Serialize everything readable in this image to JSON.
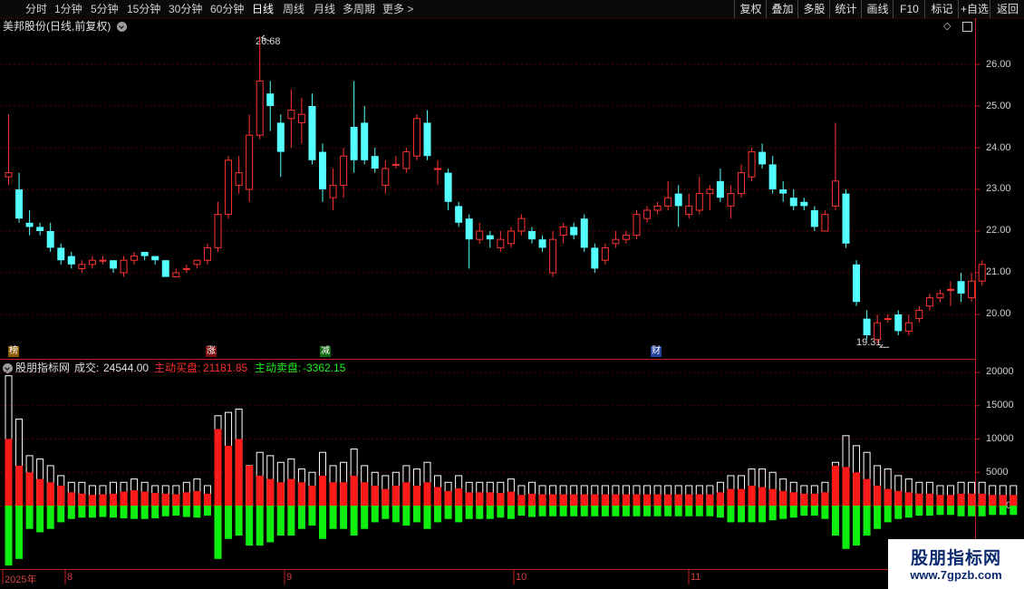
{
  "timeframes": [
    "分时",
    "1分钟",
    "5分钟",
    "15分钟",
    "30分钟",
    "60分钟",
    "日线",
    "周线",
    "月线",
    "多周期",
    "更多 >"
  ],
  "active_timeframe": "日线",
  "right_buttons": [
    "复权",
    "叠加",
    "多股",
    "统计",
    "画线",
    "F10",
    "标记",
    "+自选",
    "返回"
  ],
  "main_chart": {
    "title": "美邦股份(日线,前复权)",
    "high_label": "26.68",
    "low_label": "19.31",
    "y_labels": [
      "26.00",
      "25.00",
      "24.00",
      "23.00",
      "22.00",
      "21.00",
      "20.00"
    ],
    "event_tags": [
      "榜",
      "涨",
      "减",
      "财"
    ]
  },
  "sub_chart": {
    "name": "股朋指标网",
    "vol_label": "成交:",
    "vol_value": "24544.00",
    "buy_label": "主动买盘:",
    "buy_value": "21181.85",
    "sell_label": "主动卖盘:",
    "sell_value": "-3362.15",
    "y_labels": [
      "20000",
      "15000",
      "10000",
      "5000",
      "0"
    ]
  },
  "date_axis": [
    "2025年",
    "8",
    "9",
    "10",
    "11"
  ],
  "watermark": {
    "line1": "股朋指标网",
    "line2": "www.7gpzb.com"
  },
  "colors": {
    "up": "#ff3232",
    "down": "#54ffff",
    "buy": "#ff1a1a",
    "sell": "#10f010",
    "grid": "#5a0000",
    "axis": "#c02020"
  },
  "chart_data": [
    {
      "type": "candlestick",
      "title": "美邦股份(日线,前复权)",
      "ylim": [
        19.0,
        26.9
      ],
      "candles": [
        [
          23.3,
          23.4,
          24.8,
          23.1
        ],
        [
          23.0,
          22.3,
          23.4,
          22.2
        ],
        [
          22.2,
          22.1,
          22.5,
          21.9
        ],
        [
          22.1,
          22.0,
          22.2,
          21.9
        ],
        [
          22.0,
          21.6,
          22.2,
          21.5
        ],
        [
          21.6,
          21.3,
          21.7,
          21.2
        ],
        [
          21.4,
          21.2,
          21.5,
          21.1
        ],
        [
          21.1,
          21.2,
          21.3,
          21.0
        ],
        [
          21.2,
          21.3,
          21.4,
          21.1
        ],
        [
          21.3,
          21.3,
          21.4,
          21.2
        ],
        [
          21.3,
          21.1,
          21.3,
          21.0
        ],
        [
          21.0,
          21.3,
          21.4,
          20.9
        ],
        [
          21.3,
          21.4,
          21.5,
          21.2
        ],
        [
          21.5,
          21.4,
          21.5,
          21.3
        ],
        [
          21.4,
          21.3,
          21.4,
          21.2
        ],
        [
          21.3,
          20.9,
          21.3,
          20.9
        ],
        [
          20.9,
          21.0,
          21.1,
          20.9
        ],
        [
          21.1,
          21.1,
          21.2,
          21.0
        ],
        [
          21.2,
          21.3,
          21.3,
          21.1
        ],
        [
          21.3,
          21.6,
          21.7,
          21.2
        ],
        [
          21.6,
          22.4,
          22.7,
          21.5
        ],
        [
          22.4,
          23.7,
          23.8,
          22.3
        ],
        [
          23.1,
          23.4,
          23.8,
          22.9
        ],
        [
          23.0,
          24.3,
          24.8,
          22.7
        ],
        [
          24.3,
          25.6,
          26.68,
          24.2
        ],
        [
          25.3,
          25.0,
          25.6,
          24.4
        ],
        [
          24.6,
          23.9,
          24.8,
          23.3
        ],
        [
          24.7,
          24.9,
          25.4,
          24.0
        ],
        [
          24.6,
          24.8,
          25.2,
          24.1
        ],
        [
          25.0,
          23.7,
          25.3,
          23.6
        ],
        [
          23.9,
          23.0,
          24.1,
          22.7
        ],
        [
          22.8,
          23.1,
          23.5,
          22.5
        ],
        [
          23.1,
          23.8,
          24.0,
          22.8
        ],
        [
          24.5,
          23.7,
          25.6,
          23.4
        ],
        [
          24.6,
          23.7,
          25.0,
          23.6
        ],
        [
          23.8,
          23.5,
          24.0,
          23.4
        ],
        [
          23.1,
          23.5,
          23.7,
          22.9
        ],
        [
          23.6,
          23.6,
          23.8,
          23.5
        ],
        [
          23.5,
          23.9,
          24.0,
          23.4
        ],
        [
          23.8,
          24.7,
          24.8,
          23.7
        ],
        [
          24.6,
          23.8,
          24.9,
          23.7
        ],
        [
          23.5,
          23.5,
          23.7,
          23.1
        ],
        [
          23.4,
          22.7,
          23.5,
          22.5
        ],
        [
          22.6,
          22.2,
          22.7,
          22.1
        ],
        [
          22.3,
          21.8,
          22.4,
          21.1
        ],
        [
          21.8,
          22.0,
          22.2,
          21.7
        ],
        [
          21.9,
          21.8,
          22.0,
          21.6
        ],
        [
          21.6,
          21.8,
          22.0,
          21.5
        ],
        [
          21.7,
          22.0,
          22.1,
          21.6
        ],
        [
          22.0,
          22.3,
          22.4,
          21.9
        ],
        [
          22.0,
          21.8,
          22.1,
          21.7
        ],
        [
          21.8,
          21.6,
          21.9,
          21.5
        ],
        [
          21.0,
          21.8,
          22.0,
          20.9
        ],
        [
          21.9,
          22.1,
          22.2,
          21.7
        ],
        [
          22.1,
          21.9,
          22.2,
          21.8
        ],
        [
          22.3,
          21.6,
          22.4,
          21.5
        ],
        [
          21.6,
          21.1,
          21.7,
          21.0
        ],
        [
          21.3,
          21.6,
          21.7,
          21.2
        ],
        [
          21.7,
          21.8,
          22.0,
          21.6
        ],
        [
          21.8,
          21.9,
          22.0,
          21.7
        ],
        [
          21.9,
          22.4,
          22.5,
          21.8
        ],
        [
          22.3,
          22.5,
          22.6,
          22.2
        ],
        [
          22.5,
          22.6,
          22.7,
          22.4
        ],
        [
          22.6,
          22.8,
          23.2,
          22.5
        ],
        [
          22.9,
          22.6,
          23.1,
          22.1
        ],
        [
          22.4,
          22.6,
          22.9,
          22.3
        ],
        [
          22.5,
          22.9,
          23.3,
          22.4
        ],
        [
          22.9,
          23.0,
          23.1,
          22.5
        ],
        [
          23.2,
          22.8,
          23.5,
          22.7
        ],
        [
          22.6,
          22.9,
          23.1,
          22.3
        ],
        [
          22.9,
          23.4,
          23.6,
          22.8
        ],
        [
          23.3,
          23.9,
          24.0,
          23.2
        ],
        [
          23.9,
          23.6,
          24.1,
          23.5
        ],
        [
          23.6,
          23.0,
          23.8,
          22.9
        ],
        [
          23.0,
          22.9,
          23.2,
          22.7
        ],
        [
          22.8,
          22.6,
          23.0,
          22.5
        ],
        [
          22.7,
          22.6,
          22.8,
          22.5
        ],
        [
          22.5,
          22.1,
          22.6,
          22.0
        ],
        [
          22.0,
          22.4,
          22.5,
          22.0
        ],
        [
          22.6,
          23.2,
          24.6,
          22.5
        ],
        [
          22.9,
          21.7,
          23.0,
          21.6
        ],
        [
          21.2,
          20.3,
          21.3,
          20.2
        ],
        [
          19.9,
          19.5,
          20.1,
          19.4
        ],
        [
          19.4,
          19.8,
          20.0,
          19.3
        ],
        [
          19.9,
          19.9,
          20.0,
          19.8
        ],
        [
          20.0,
          19.6,
          20.1,
          19.5
        ],
        [
          19.6,
          19.8,
          20.0,
          19.5
        ],
        [
          19.9,
          20.1,
          20.2,
          19.8
        ],
        [
          20.2,
          20.4,
          20.5,
          20.1
        ],
        [
          20.4,
          20.5,
          20.6,
          20.3
        ],
        [
          20.6,
          20.6,
          20.8,
          20.2
        ],
        [
          20.8,
          20.5,
          21.0,
          20.3
        ],
        [
          20.4,
          20.8,
          21.0,
          20.3
        ],
        [
          20.8,
          21.2,
          21.3,
          20.7
        ]
      ]
    },
    {
      "type": "bar",
      "title": "股朋指标网",
      "series": [
        {
          "name": "成交",
          "values": [
            19500,
            13000,
            7500,
            7000,
            6000,
            4500,
            3500,
            3500,
            3000,
            3000,
            3500,
            3500,
            4000,
            3500,
            3000,
            3000,
            3000,
            3500,
            4000,
            3000,
            13500,
            14000,
            14500,
            6000,
            8000,
            7500,
            6500,
            7000,
            5500,
            5000,
            8000,
            6000,
            6500,
            8500,
            6000,
            5000,
            4500,
            5000,
            6000,
            5500,
            6500,
            4500,
            3500,
            4500,
            3500,
            3500,
            3500,
            3500,
            4000,
            3000,
            3500,
            3000,
            3000,
            3000,
            3000,
            3000,
            3000,
            3000,
            3000,
            3000,
            3000,
            3000,
            3000,
            3000,
            3000,
            3000,
            3000,
            3000,
            3500,
            4500,
            4500,
            5500,
            5500,
            5000,
            4000,
            3500,
            3000,
            3000,
            3500,
            6500,
            10500,
            9000,
            8000,
            6000,
            5500,
            4500,
            4000,
            3500,
            3500,
            3000,
            3000,
            3500,
            3500,
            3500,
            3000,
            3000,
            3000
          ]
        },
        {
          "name": "主动买盘",
          "values": [
            10000,
            6000,
            5000,
            4000,
            3500,
            3000,
            2000,
            1800,
            1600,
            1700,
            1800,
            2100,
            2300,
            2100,
            1900,
            1800,
            1700,
            2000,
            2200,
            1800,
            11500,
            9000,
            10000,
            6000,
            4500,
            4000,
            3500,
            4000,
            3500,
            3000,
            4500,
            3500,
            3500,
            4500,
            3500,
            3000,
            2500,
            3000,
            3500,
            3000,
            3500,
            2800,
            2200,
            2600,
            2000,
            2000,
            2000,
            1900,
            2100,
            1600,
            1800,
            1700,
            1700,
            1700,
            1700,
            1700,
            1700,
            1700,
            1700,
            1700,
            1700,
            1700,
            1700,
            1700,
            1700,
            1700,
            1700,
            1700,
            2000,
            2500,
            2500,
            3000,
            2800,
            2500,
            2200,
            2000,
            1800,
            1800,
            2000,
            6000,
            5800,
            5000,
            4000,
            3000,
            2500,
            2200,
            2000,
            1800,
            1800,
            1600,
            1600,
            1800,
            1800,
            1800,
            1600,
            1600,
            1600
          ]
        },
        {
          "name": "主动卖盘",
          "values": [
            -9000,
            -8000,
            -3500,
            -4000,
            -3500,
            -2500,
            -2000,
            -1800,
            -1800,
            -1700,
            -1800,
            -1900,
            -2000,
            -2000,
            -1900,
            -1600,
            -1500,
            -1700,
            -1800,
            -1500,
            -8000,
            -5000,
            -4500,
            -6000,
            -6000,
            -5500,
            -4500,
            -4500,
            -3500,
            -3000,
            -5000,
            -3500,
            -3500,
            -4500,
            -3500,
            -2500,
            -2000,
            -2500,
            -3000,
            -2500,
            -3500,
            -2500,
            -2000,
            -2500,
            -2000,
            -2000,
            -2000,
            -1800,
            -2000,
            -1500,
            -1700,
            -1600,
            -1600,
            -1600,
            -1600,
            -1600,
            -1600,
            -1600,
            -1600,
            -1600,
            -1600,
            -1600,
            -1600,
            -1600,
            -1600,
            -1600,
            -1600,
            -1600,
            -1800,
            -2500,
            -2500,
            -2500,
            -2500,
            -2200,
            -2000,
            -1800,
            -1500,
            -1500,
            -2000,
            -4500,
            -6500,
            -6000,
            -4500,
            -3500,
            -2500,
            -2000,
            -1800,
            -1500,
            -1500,
            -1400,
            -1400,
            -1600,
            -1600,
            -1600,
            -1400,
            -1400,
            -1400
          ]
        }
      ],
      "ylim": [
        -9500,
        21000
      ]
    }
  ]
}
